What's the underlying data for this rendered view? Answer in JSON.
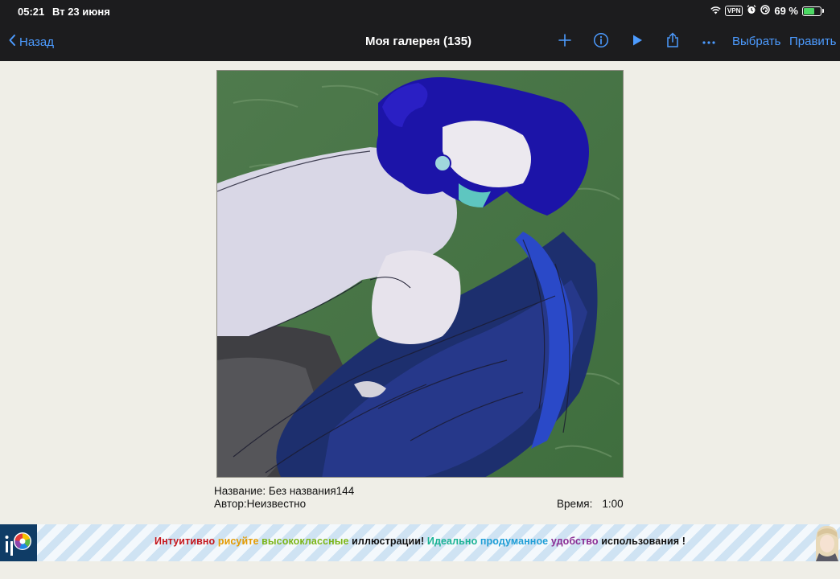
{
  "status_bar": {
    "time": "05:21",
    "date": "Вт 23 июня",
    "vpn": "VPN",
    "battery": "69 %",
    "battery_level": 0.69
  },
  "nav": {
    "back_label": "Назад",
    "title": "Моя галерея (135)",
    "select_label": "Выбрать",
    "edit_label": "Править"
  },
  "artwork_info": {
    "title": "Название: Без названия144",
    "author": "Автор:Неизвестно",
    "time_label": "Время:",
    "time_value": "1:00"
  },
  "banner": {
    "segments": [
      {
        "text": "Интуитивно",
        "color": "#c4161c"
      },
      {
        "text": " рисуйте",
        "color": "#e39a00"
      },
      {
        "text": " высококлассные",
        "color": "#7cb518"
      },
      {
        "text": " иллюстрации!",
        "color": "#111111"
      },
      {
        "text": " Идеально",
        "color": "#1ab394"
      },
      {
        "text": " продуманное",
        "color": "#1e9ed6"
      },
      {
        "text": " удобство",
        "color": "#8a2c94"
      },
      {
        "text": " использования !",
        "color": "#111111"
      }
    ]
  },
  "colors": {
    "accent": "#4c9bff",
    "bar_background": "#1c1c1e",
    "page_background": "#efeee7"
  }
}
